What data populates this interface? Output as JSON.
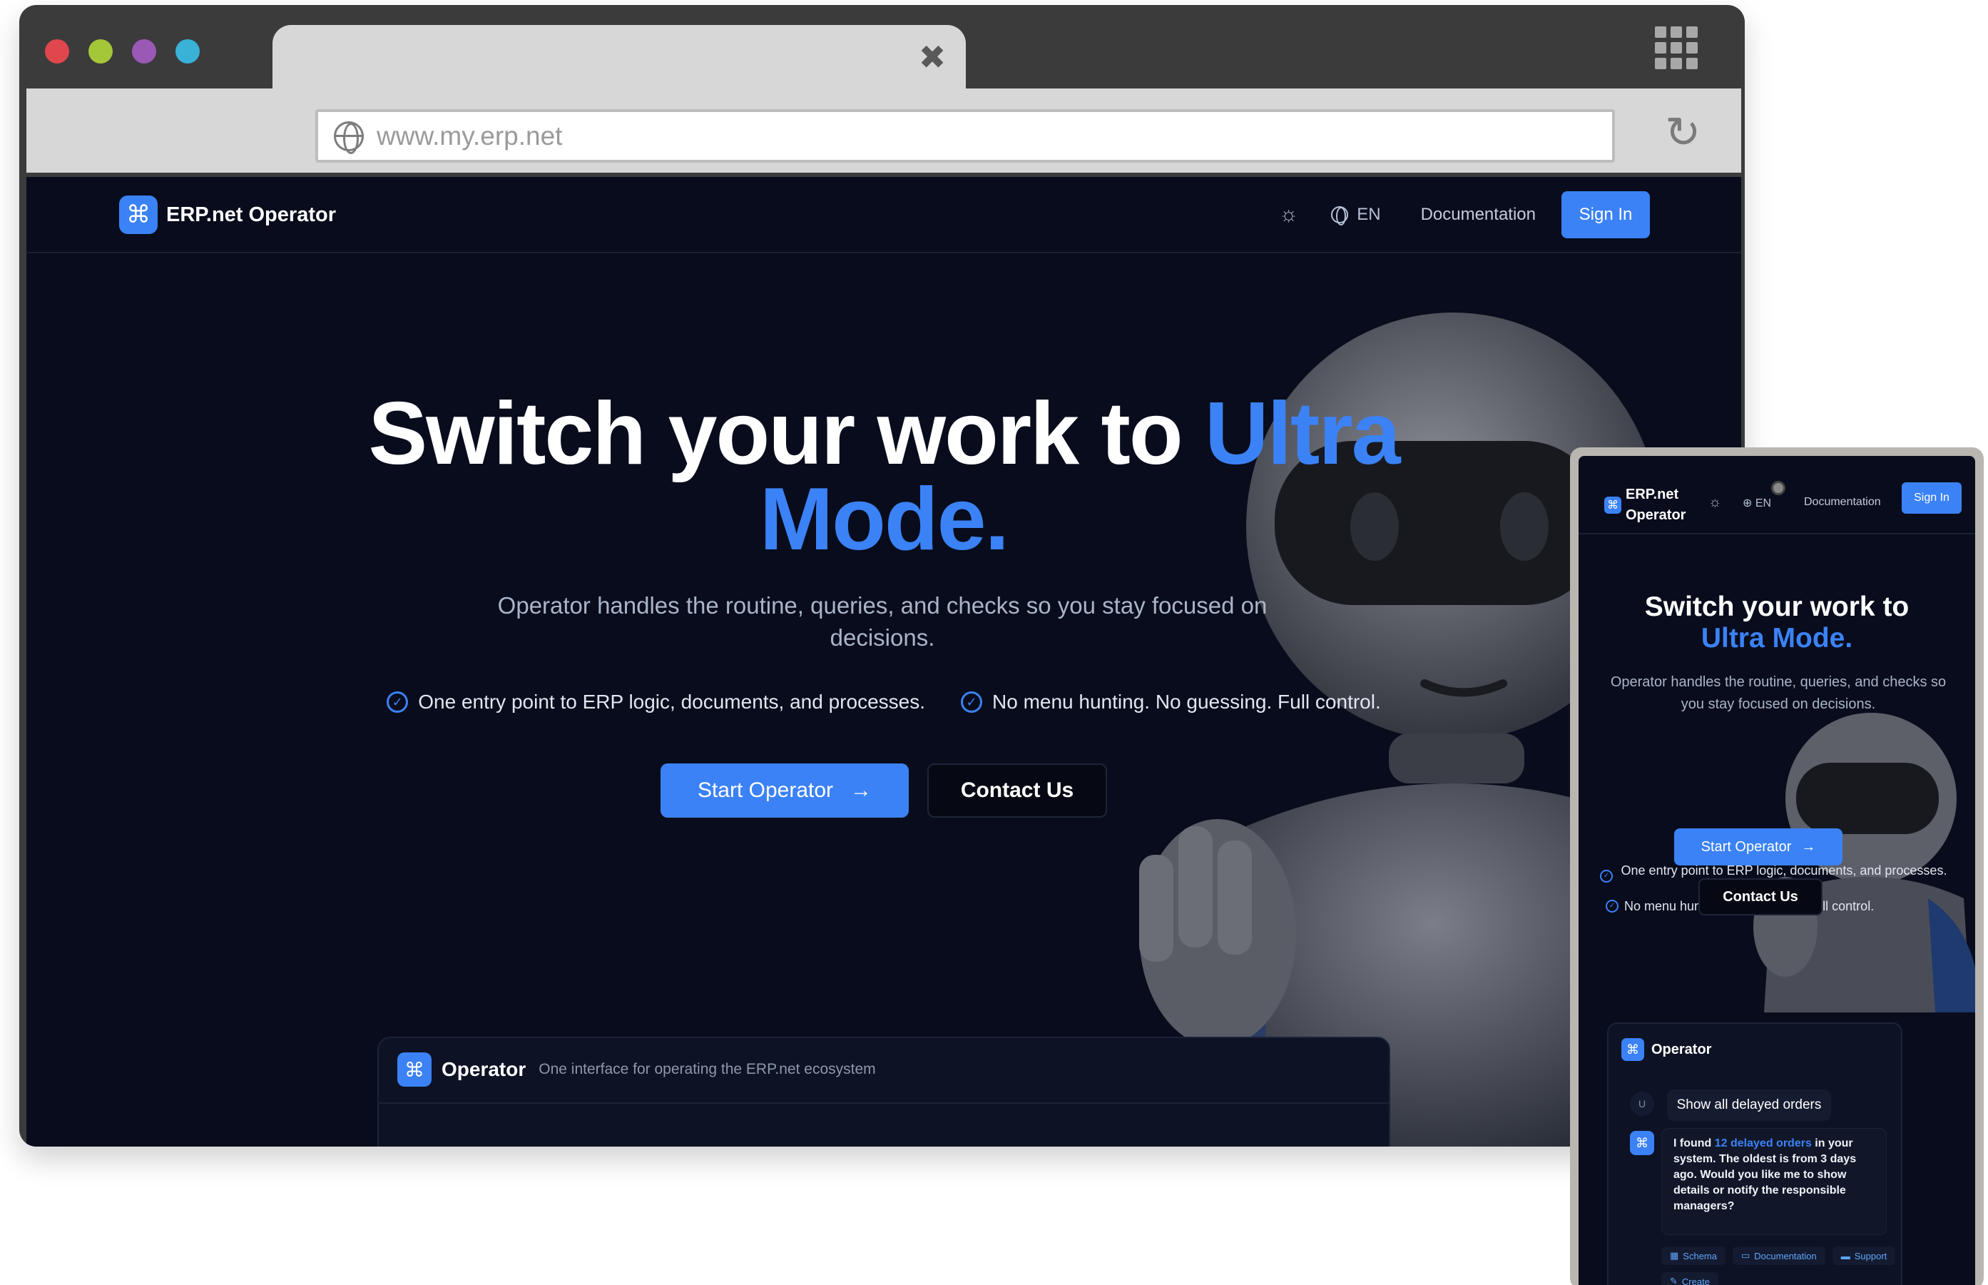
{
  "browser": {
    "url": "www.my.erp.net",
    "traffic_colors": [
      "#e0474c",
      "#a4c639",
      "#9b59b6",
      "#3ab1d6"
    ]
  },
  "site": {
    "brand": "ERP.net Operator",
    "nav": {
      "language": "EN",
      "documentation": "Documentation",
      "sign_in": "Sign In"
    },
    "hero": {
      "title_line1_white": "Switch your work to ",
      "title_line1_blue": "Ultra",
      "title_line2_blue": "Mode.",
      "subtitle": "Operator handles the routine, queries, and checks so you stay focused on decisions.",
      "checks": [
        "One entry point to ERP logic, documents, and processes.",
        "No menu hunting. No guessing. Full control."
      ],
      "primary_cta": "Start Operator",
      "secondary_cta": "Contact Us"
    },
    "operator_card": {
      "title": "Operator",
      "description": "One interface for operating the ERP.net ecosystem"
    }
  },
  "phone": {
    "brand_line1": "ERP.net",
    "brand_line2": "Operator",
    "language": "EN",
    "documentation": "Documentation",
    "sign_in": "Sign In",
    "title_white": "Switch your work to",
    "title_blue": "Ultra Mode.",
    "subtitle": "Operator handles the routine, queries, and checks so you stay focused on decisions.",
    "check1": "One entry point to ERP logic, documents, and processes.",
    "check2": "No menu hunting. No guessing. Full control.",
    "primary_cta": "Start Operator",
    "secondary_cta": "Contact Us",
    "card_title": "Operator",
    "user_initial": "U",
    "user_message": "Show all delayed orders",
    "bot_message_pre": "I found ",
    "bot_message_link": "12 delayed orders",
    "bot_message_post": " in your system. The oldest is from 3 days ago. Would you like me to show details or notify the responsible managers?",
    "chips": [
      "Schema",
      "Documentation",
      "Support",
      "Create"
    ]
  },
  "colors": {
    "accent": "#3b82f6",
    "page_bg": "#080c1c"
  }
}
